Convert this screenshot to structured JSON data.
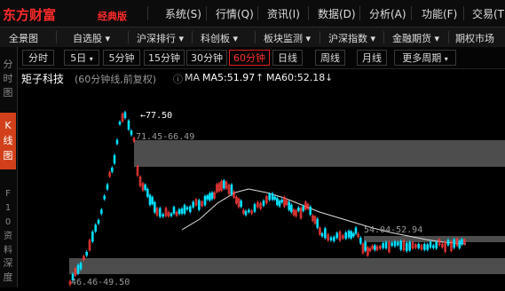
{
  "app": {
    "logo": "东方财富",
    "edition": "经典版",
    "menu": [
      "系统(S)",
      "行情(Q)",
      "资讯(I)",
      "数据(D)",
      "分析(A)",
      "功能(F)",
      "交易(T)"
    ]
  },
  "nav": {
    "items": [
      "全景图",
      "自选股",
      "沪深排行",
      "科创板",
      "板块监测",
      "沪深指数",
      "金融期货",
      "期权市场"
    ]
  },
  "left_panel": {
    "items": [
      "分时图",
      "K线图",
      "F10资料",
      "深度"
    ]
  },
  "periods": {
    "tabs": [
      "分时",
      "5日",
      "5分钟",
      "15分钟",
      "30分钟",
      "60分钟",
      "日线",
      "周线",
      "月线",
      "更多周期"
    ],
    "active": "60分钟"
  },
  "stock_info": {
    "name": "矩子科技",
    "mode": "(60分钟线,前复权)",
    "indicator": "MA",
    "ma5_label": "MA5:51.97",
    "ma60_label": "MA60:52.18",
    "colors": {
      "name": "#ffffff",
      "ma5": "#ffffff",
      "ma60": "#f0f0f0"
    }
  },
  "chart_data": {
    "type": "candlestick",
    "annotations": {
      "high_marker": "77.50",
      "gap_zones": [
        "71.45-66.49",
        "54.04-52.94",
        "46.46-49.50"
      ]
    },
    "colors": {
      "up": "#ff3b3b",
      "down": "#00e0ff",
      "gap_zone": "#5a5a5a",
      "ma": "#dcdcdc"
    }
  }
}
